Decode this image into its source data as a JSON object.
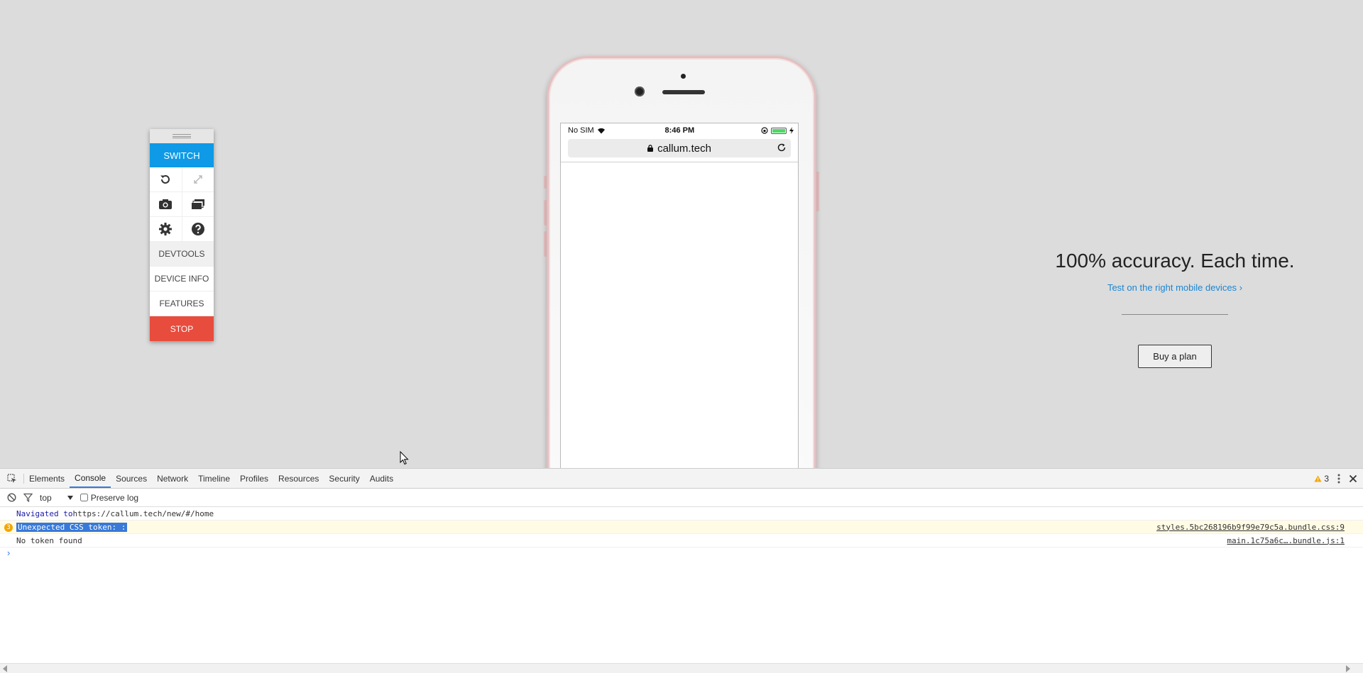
{
  "toolbar": {
    "switch_label": "SWITCH",
    "devtools_label": "DEVTOOLS",
    "device_info_label": "DEVICE INFO",
    "features_label": "FEATURES",
    "stop_label": "STOP",
    "colors": {
      "switch": "#0e9ae6",
      "stop": "#e84c3d"
    }
  },
  "phone": {
    "status": {
      "carrier": "No SIM",
      "time": "8:46 PM"
    },
    "url": "callum.tech",
    "battery_level": 1.0
  },
  "promo": {
    "headline": "100% accuracy. Each time.",
    "link": "Test on the right mobile devices",
    "button": "Buy a plan",
    "link_color": "#1a86d2"
  },
  "devtools": {
    "tabs": [
      "Elements",
      "Console",
      "Sources",
      "Network",
      "Timeline",
      "Profiles",
      "Resources",
      "Security",
      "Audits"
    ],
    "active_tab": "Console",
    "warning_count": "3",
    "context": "top",
    "preserve_log_label": "Preserve log",
    "console": [
      {
        "prefix": "Navigated to ",
        "text": "https://callum.tech/new/#/home",
        "source": ""
      },
      {
        "badge": "3",
        "text": "Unexpected CSS token: :",
        "source": "styles.5bc268196b9f99e79c5a.bundle.css:9"
      },
      {
        "text": "No token found",
        "source": "main.1c75a6c….bundle.js:1"
      }
    ],
    "prompt": "›"
  }
}
